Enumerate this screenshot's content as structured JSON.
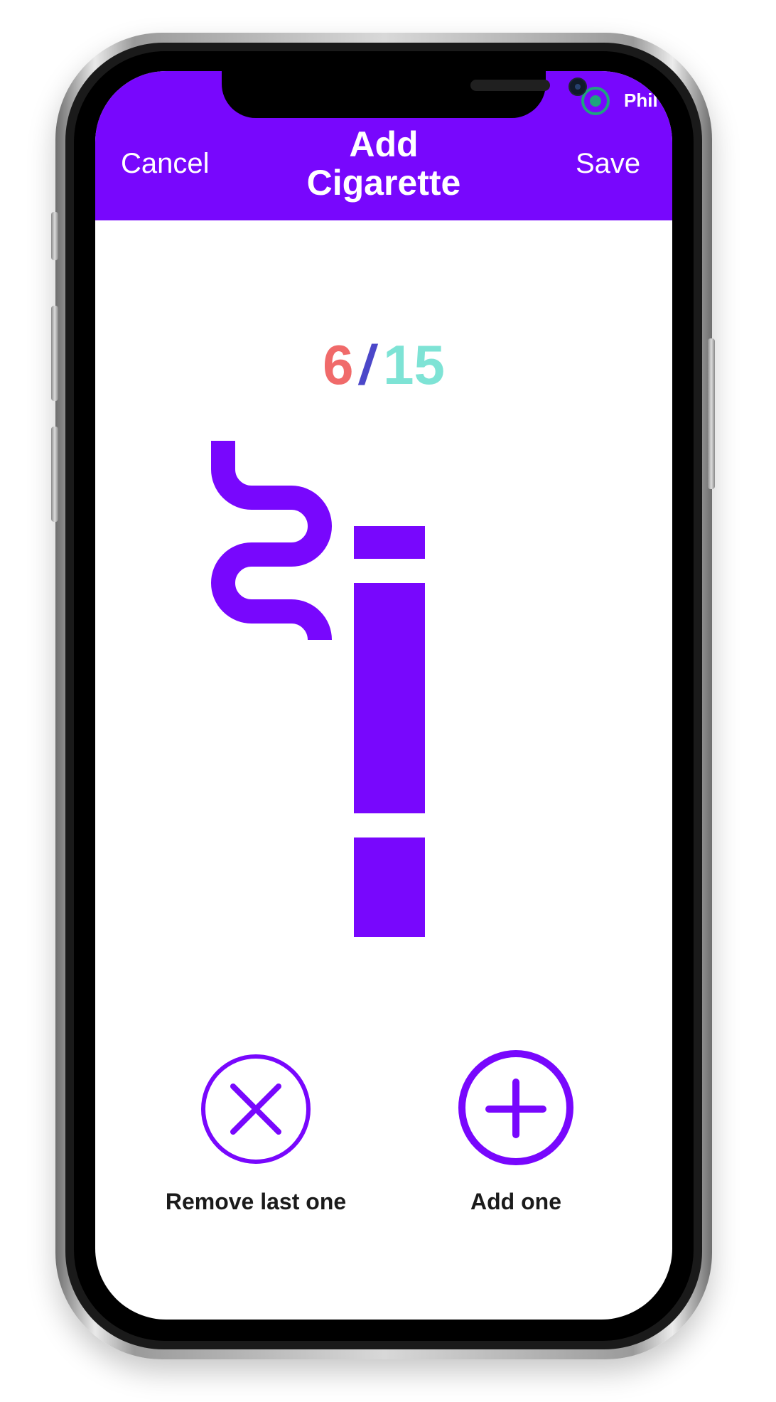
{
  "header": {
    "cancel_label": "Cancel",
    "title_line1": "Add",
    "title_line2": "Cigarette",
    "save_label": "Save",
    "user_name": "Phil",
    "color": "#7807fd"
  },
  "counter": {
    "current": "6",
    "separator": "/",
    "total": "15",
    "current_color": "#f06a6a",
    "separator_color": "#4b47c9",
    "total_color": "#7ee3d5"
  },
  "illustration": {
    "icon": "cigarette-icon",
    "color": "#7807fd"
  },
  "actions": {
    "remove": {
      "icon": "close-icon",
      "label": "Remove last one"
    },
    "add": {
      "icon": "plus-icon",
      "label": "Add one"
    }
  }
}
